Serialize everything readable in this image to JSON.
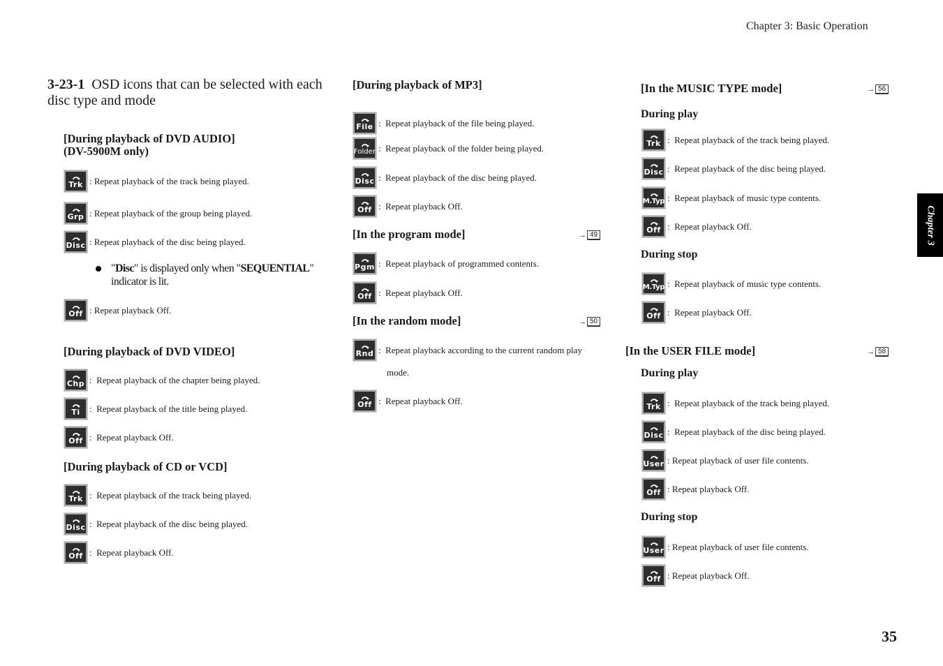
{
  "header": {
    "running_head": "Chapter 3: Basic Operation",
    "page_number": "35",
    "chapter_tab": "Chapter 3"
  },
  "title": {
    "number": "3-23-1",
    "text": "OSD icons that can be selected with each disc type and mode"
  },
  "sections": {
    "dvd_audio": {
      "heading": "[During playback of DVD AUDIO]",
      "subheading": "(DV-5900M only)",
      "items": [
        {
          "icon": "Trk",
          "text": ": Repeat playback of the track being played."
        },
        {
          "icon": "Grp",
          "text": ": Repeat playback of the group being played."
        },
        {
          "icon": "Disc",
          "text": ": Repeat playback of the disc being played."
        },
        {
          "icon": "Off",
          "text": ": Repeat playback Off."
        }
      ],
      "note": {
        "q1": "\"",
        "b1": "Disc",
        "t1": "\" is displayed only when \"",
        "b2": "SEQUENTIAL",
        "t2": "\"",
        "line2": "indicator is lit."
      }
    },
    "dvd_video": {
      "heading": "[During playback of DVD VIDEO]",
      "items": [
        {
          "icon": "Chp",
          "text": ":  Repeat playback of the chapter being played."
        },
        {
          "icon": "Ti",
          "text": ":  Repeat playback of the title being played."
        },
        {
          "icon": "Off",
          "text": ":  Repeat playback Off."
        }
      ]
    },
    "cd_vcd": {
      "heading": "[During playback of CD or VCD]",
      "items": [
        {
          "icon": "Trk",
          "text": ":  Repeat playback of the track being played."
        },
        {
          "icon": "Disc",
          "text": ":  Repeat playback of the disc being played."
        },
        {
          "icon": "Off",
          "text": ":  Repeat playback Off."
        }
      ]
    },
    "mp3": {
      "heading": "[During playback of MP3]",
      "items": [
        {
          "icon": "File",
          "text": ":  Repeat playback of the file being played."
        },
        {
          "icon": "Folder",
          "text": ":  Repeat playback of the folder being played."
        },
        {
          "icon": "Disc",
          "text": ":  Repeat playback of the disc being played."
        },
        {
          "icon": "Off",
          "text": ":  Repeat playback Off."
        }
      ]
    },
    "program": {
      "heading": "[In the program mode]",
      "ref_page": "49",
      "items": [
        {
          "icon": "Pgm",
          "text": ":  Repeat playback of programmed contents."
        },
        {
          "icon": "Off",
          "text": ":  Repeat playback Off."
        }
      ]
    },
    "random": {
      "heading": "[In the random mode]",
      "ref_page": "50",
      "items": [
        {
          "icon": "Rnd",
          "text": ":  Repeat playback according to the current random play",
          "text2": "mode."
        },
        {
          "icon": "Off",
          "text": ":  Repeat playback Off."
        }
      ]
    },
    "music_type": {
      "heading": "[In the MUSIC TYPE mode]",
      "ref_page": "56",
      "play_heading": "During play",
      "play_items": [
        {
          "icon": "Trk",
          "text": ":  Repeat playback of the track being played."
        },
        {
          "icon": "Disc",
          "text": ":  Repeat playback of the disc being played."
        },
        {
          "icon": "M.Typ",
          "text": ":  Repeat playback of music type contents."
        },
        {
          "icon": "Off",
          "text": ":  Repeat playback Off."
        }
      ],
      "stop_heading": "During stop",
      "stop_items": [
        {
          "icon": "M.Typ",
          "text": ":  Repeat playback of music type contents."
        },
        {
          "icon": "Off",
          "text": ":  Repeat playback Off."
        }
      ]
    },
    "user_file": {
      "heading": "[In the USER FILE mode]",
      "ref_page": "58",
      "play_heading": "During play",
      "play_items": [
        {
          "icon": "Trk",
          "text": ":  Repeat playback of the track being played."
        },
        {
          "icon": "Disc",
          "text": ":  Repeat playback of the disc being played."
        },
        {
          "icon": "User",
          "text": ": Repeat playback of user file contents."
        },
        {
          "icon": "Off",
          "text": ": Repeat playback Off."
        }
      ],
      "stop_heading": "During stop",
      "stop_items": [
        {
          "icon": "User",
          "text": ": Repeat playback of user file contents."
        },
        {
          "icon": "Off",
          "text": ": Repeat playback Off."
        }
      ]
    }
  }
}
